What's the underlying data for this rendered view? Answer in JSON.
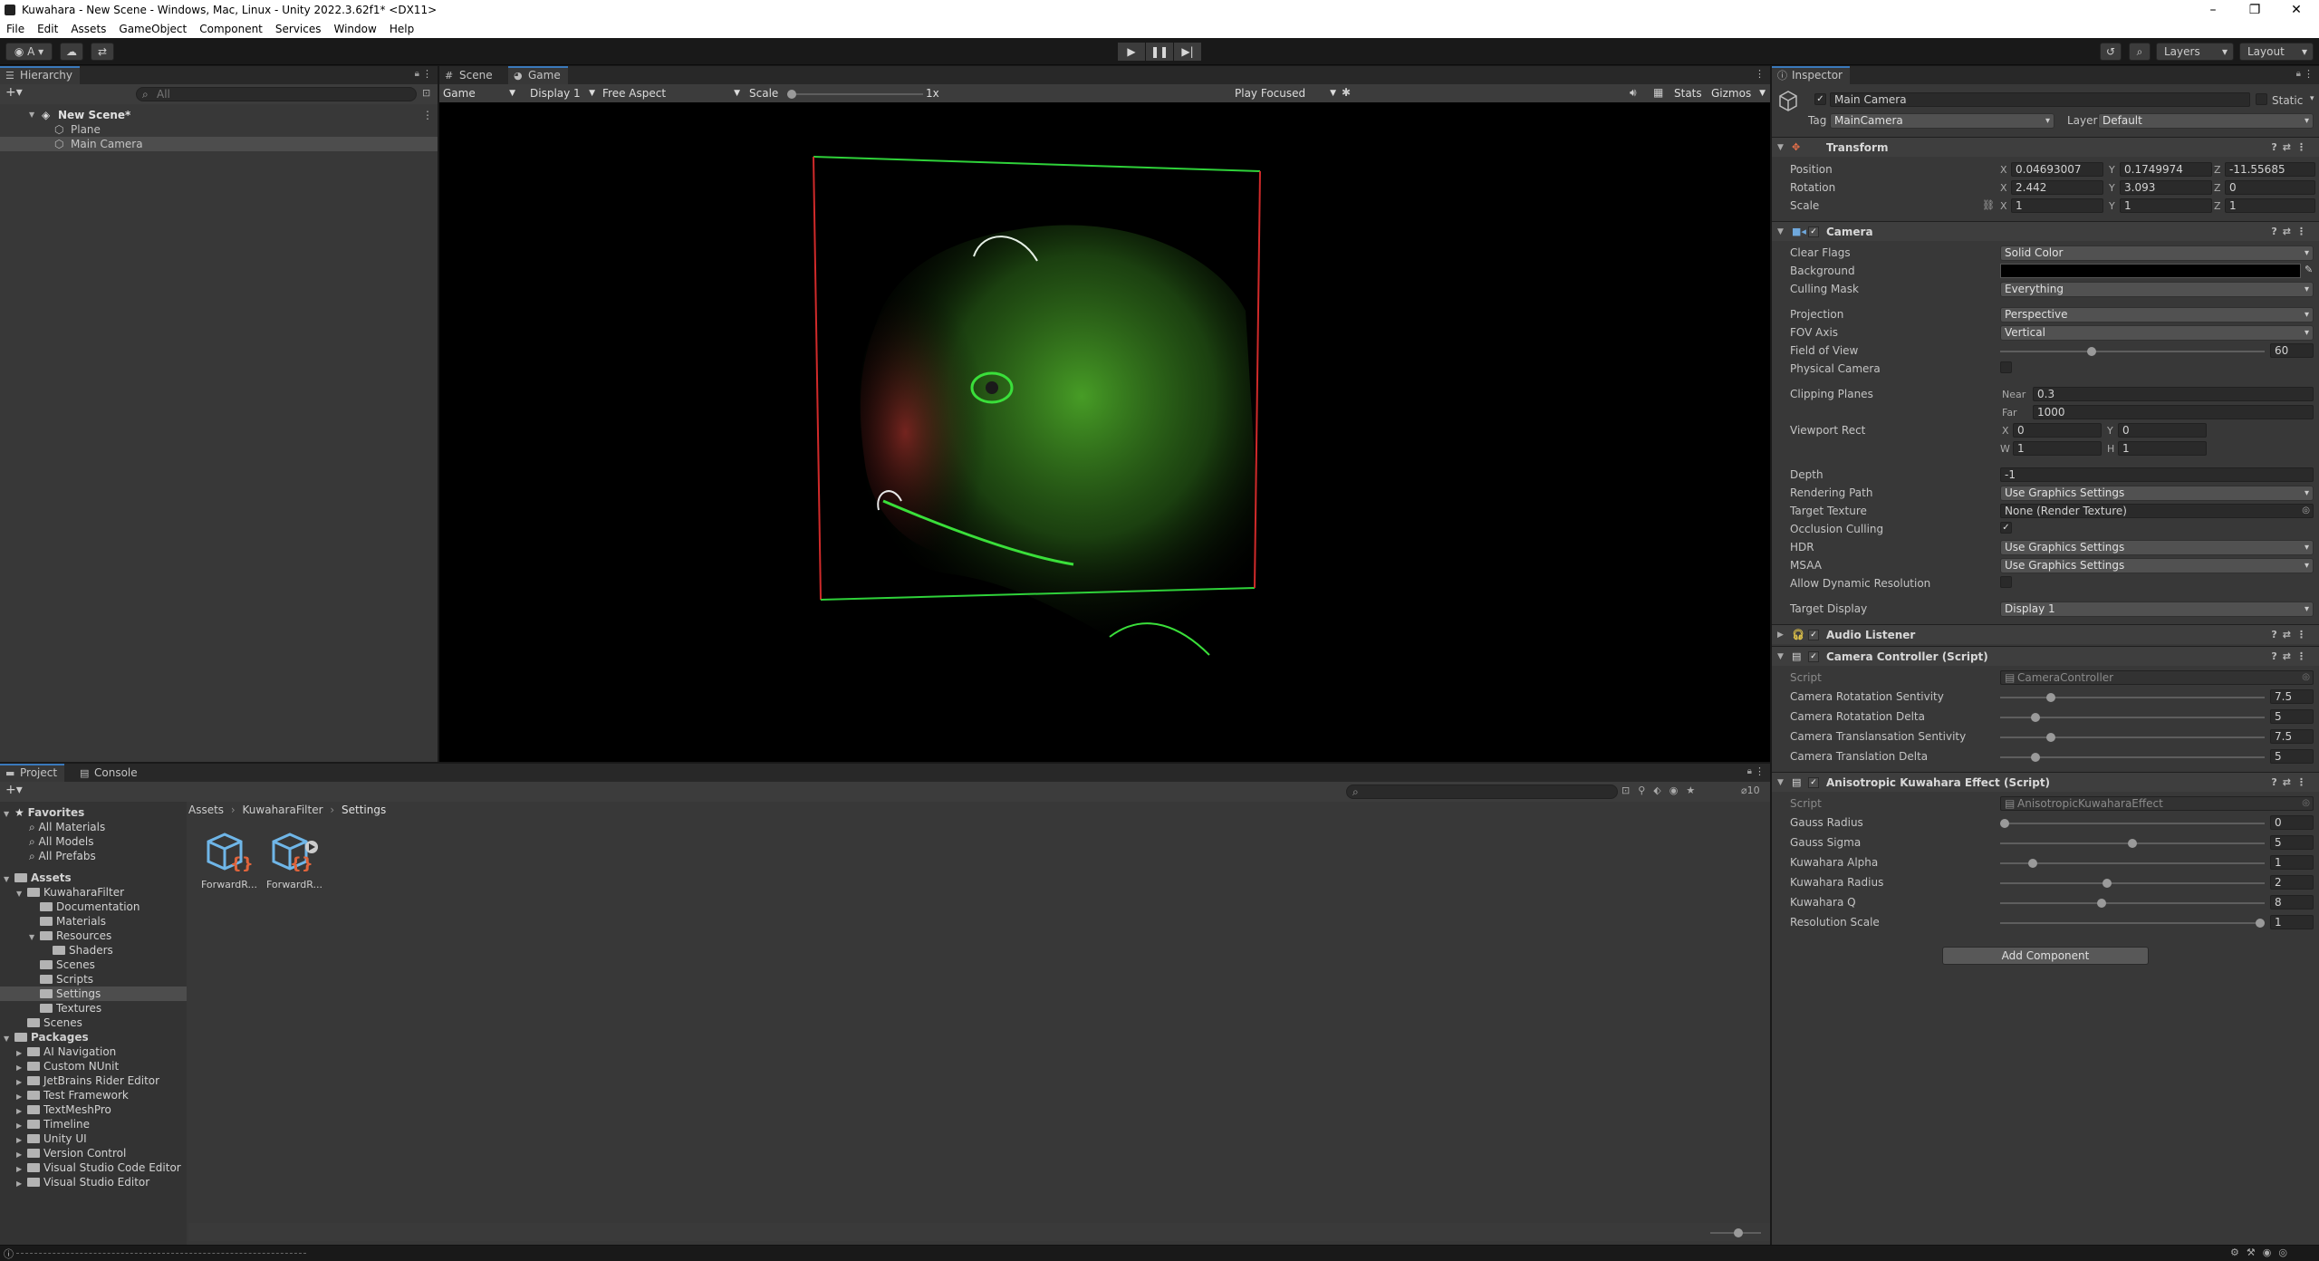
{
  "window": {
    "title": "Kuwahara - New Scene - Windows, Mac, Linux - Unity 2022.3.62f1* <DX11>",
    "controls": [
      "–",
      "❐",
      "✕"
    ]
  },
  "menu": [
    "File",
    "Edit",
    "Assets",
    "GameObject",
    "Component",
    "Services",
    "Window",
    "Help"
  ],
  "toolbar": {
    "account": "A",
    "layers": "Layers",
    "layout": "Layout"
  },
  "hierarchy": {
    "tab": "Hierarchy",
    "search_placeholder": "All",
    "scene": "New Scene*",
    "items": [
      "Plane",
      "Main Camera"
    ]
  },
  "scene_tabs": [
    "Scene",
    "Game"
  ],
  "game_bar": {
    "mode": "Game",
    "display": "Display 1",
    "aspect": "Free Aspect",
    "scale_label": "Scale",
    "scale_value": "1x",
    "play_focused": "Play Focused",
    "stats": "Stats",
    "gizmos": "Gizmos"
  },
  "inspector": {
    "tab": "Inspector",
    "object_name": "Main Camera",
    "static_label": "Static",
    "tag_label": "Tag",
    "tag_value": "MainCamera",
    "layer_label": "Layer",
    "layer_value": "Default",
    "transform": {
      "title": "Transform",
      "position_label": "Position",
      "pos": [
        "0.04693007",
        "0.1749974",
        "-11.55685"
      ],
      "rotation_label": "Rotation",
      "rot": [
        "2.442",
        "3.093",
        "0"
      ],
      "scale_label": "Scale",
      "scl": [
        "1",
        "1",
        "1"
      ]
    },
    "camera": {
      "title": "Camera",
      "clear_flags_label": "Clear Flags",
      "clear_flags": "Solid Color",
      "background_label": "Background",
      "culling_mask_label": "Culling Mask",
      "culling_mask": "Everything",
      "projection_label": "Projection",
      "projection": "Perspective",
      "fov_axis_label": "FOV Axis",
      "fov_axis": "Vertical",
      "fov_label": "Field of View",
      "fov": "60",
      "physical_label": "Physical Camera",
      "clipping_label": "Clipping Planes",
      "near_label": "Near",
      "near": "0.3",
      "far_label": "Far",
      "far": "1000",
      "viewport_label": "Viewport Rect",
      "vx": "0",
      "vy": "0",
      "vw": "1",
      "vh": "1",
      "depth_label": "Depth",
      "depth": "-1",
      "rendering_path_label": "Rendering Path",
      "rendering_path": "Use Graphics Settings",
      "target_texture_label": "Target Texture",
      "target_texture": "None (Render Texture)",
      "occlusion_label": "Occlusion Culling",
      "hdr_label": "HDR",
      "hdr": "Use Graphics Settings",
      "msaa_label": "MSAA",
      "msaa": "Use Graphics Settings",
      "dynres_label": "Allow Dynamic Resolution",
      "target_display_label": "Target Display",
      "target_display": "Display 1"
    },
    "audio_listener": {
      "title": "Audio Listener"
    },
    "camera_controller": {
      "title": "Camera Controller (Script)",
      "script_label": "Script",
      "script": "CameraController",
      "fields": [
        {
          "label": "Camera Rotatation Sentivity",
          "value": "7.5",
          "fraction": 0.18
        },
        {
          "label": "Camera Rotatation Delta",
          "value": "5",
          "fraction": 0.12
        },
        {
          "label": "Camera Translansation Sentivity",
          "value": "7.5",
          "fraction": 0.18
        },
        {
          "label": "Camera Translation Delta",
          "value": "5",
          "fraction": 0.12
        }
      ]
    },
    "kuwahara": {
      "title": "Anisotropic Kuwahara Effect (Script)",
      "script_label": "Script",
      "script": "AnisotropicKuwaharaEffect",
      "fields": [
        {
          "label": "Gauss Radius",
          "value": "0",
          "fraction": 0.0
        },
        {
          "label": "Gauss Sigma",
          "value": "5",
          "fraction": 0.5
        },
        {
          "label": "Kuwahara Alpha",
          "value": "1",
          "fraction": 0.11
        },
        {
          "label": "Kuwahara Radius",
          "value": "2",
          "fraction": 0.4
        },
        {
          "label": "Kuwahara Q",
          "value": "8",
          "fraction": 0.38
        },
        {
          "label": "Resolution Scale",
          "value": "1",
          "fraction": 1.0
        }
      ]
    },
    "add_component": "Add Component"
  },
  "project": {
    "tabs": [
      "Project",
      "Console"
    ],
    "count": "10",
    "breadcrumb": [
      "Assets",
      "KuwaharaFilter",
      "Settings"
    ],
    "favorites_label": "Favorites",
    "favorites": [
      "All Materials",
      "All Models",
      "All Prefabs"
    ],
    "assets_label": "Assets",
    "kuwahara_folder": "KuwaharaFilter",
    "sub_folders": [
      "Documentation",
      "Materials"
    ],
    "resources": "Resources",
    "shaders": "Shaders",
    "sub_folders2": [
      "Scenes",
      "Scripts",
      "Settings",
      "Textures"
    ],
    "scenes": "Scenes",
    "packages_label": "Packages",
    "packages": [
      "AI Navigation",
      "Custom NUnit",
      "JetBrains Rider Editor",
      "Test Framework",
      "TextMeshPro",
      "Timeline",
      "Unity UI",
      "Version Control",
      "Visual Studio Code Editor",
      "Visual Studio Editor"
    ],
    "assets": [
      "ForwardR...",
      "ForwardR..."
    ]
  },
  "colors": {
    "accent": "#3a79bb",
    "frame_green": "#2fd23a",
    "frame_red": "#d02a2a"
  }
}
